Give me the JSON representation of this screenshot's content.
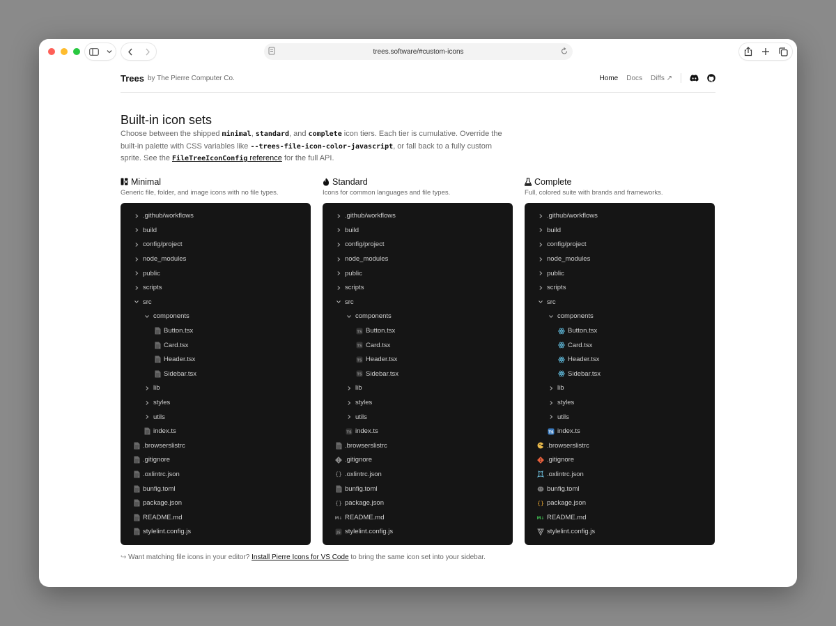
{
  "browser": {
    "url": "trees.software/#custom-icons"
  },
  "nav": {
    "brand": "Trees",
    "by": "by The Pierre Computer Co.",
    "links": [
      "Home",
      "Docs",
      "Diffs ↗"
    ]
  },
  "section": {
    "title": "Built-in icon sets",
    "desc_1": "Choose between the shipped ",
    "code_minimal": "minimal",
    "desc_2": ", ",
    "code_standard": "standard",
    "desc_3": ", and ",
    "code_complete": "complete",
    "desc_4": " icon tiers. Each tier is cumulative. Override the built-in palette with CSS variables like ",
    "code_var": "--trees-file-icon-color-javascript",
    "desc_5": ", or fall back to a fully custom sprite. See the ",
    "code_ref": "FileTreeIconConfig",
    "ref_label": " reference",
    "desc_6": " for the full API."
  },
  "columns": [
    {
      "title": "Minimal",
      "icon": "tree-icon",
      "subtitle": "Generic file, folder, and image icons with no file types."
    },
    {
      "title": "Standard",
      "icon": "flame-icon",
      "subtitle": "Icons for common languages and file types."
    },
    {
      "title": "Complete",
      "icon": "flask-icon",
      "subtitle": "Full, colored suite with brands and frameworks."
    }
  ],
  "tree": [
    {
      "label": ".github/workflows",
      "depth": 0,
      "type": "folder",
      "open": false
    },
    {
      "label": "build",
      "depth": 0,
      "type": "folder",
      "open": false
    },
    {
      "label": "config/project",
      "depth": 0,
      "type": "folder",
      "open": false
    },
    {
      "label": "node_modules",
      "depth": 0,
      "type": "folder",
      "open": false
    },
    {
      "label": "public",
      "depth": 0,
      "type": "folder",
      "open": false
    },
    {
      "label": "scripts",
      "depth": 0,
      "type": "folder",
      "open": false
    },
    {
      "label": "src",
      "depth": 0,
      "type": "folder",
      "open": true
    },
    {
      "label": "components",
      "depth": 1,
      "type": "folder",
      "open": true
    },
    {
      "label": "Button.tsx",
      "depth": 2,
      "type": "file",
      "std": "ts",
      "cmp": "react"
    },
    {
      "label": "Card.tsx",
      "depth": 2,
      "type": "file",
      "std": "ts",
      "cmp": "react"
    },
    {
      "label": "Header.tsx",
      "depth": 2,
      "type": "file",
      "std": "ts",
      "cmp": "react"
    },
    {
      "label": "Sidebar.tsx",
      "depth": 2,
      "type": "file",
      "std": "ts",
      "cmp": "react"
    },
    {
      "label": "lib",
      "depth": 1,
      "type": "folder",
      "open": false
    },
    {
      "label": "styles",
      "depth": 1,
      "type": "folder",
      "open": false
    },
    {
      "label": "utils",
      "depth": 1,
      "type": "folder",
      "open": false
    },
    {
      "label": "index.ts",
      "depth": 1,
      "type": "file",
      "std": "ts",
      "cmp": "tsblue"
    },
    {
      "label": ".browserslistrc",
      "depth": 0,
      "type": "file",
      "std": "doc",
      "cmp": "browsers"
    },
    {
      "label": ".gitignore",
      "depth": 0,
      "type": "file",
      "std": "git",
      "cmp": "git"
    },
    {
      "label": ".oxlintrc.json",
      "depth": 0,
      "type": "file",
      "std": "json",
      "cmp": "oxlint"
    },
    {
      "label": "bunfig.toml",
      "depth": 0,
      "type": "file",
      "std": "doc",
      "cmp": "bun"
    },
    {
      "label": "package.json",
      "depth": 0,
      "type": "file",
      "std": "json",
      "cmp": "jsonorange"
    },
    {
      "label": "README.md",
      "depth": 0,
      "type": "file",
      "std": "md",
      "cmp": "md"
    },
    {
      "label": "stylelint.config.js",
      "depth": 0,
      "type": "file",
      "std": "js",
      "cmp": "stylelint"
    }
  ],
  "hint": {
    "before": "Want matching file icons in your editor? ",
    "link": "Install Pierre Icons for VS Code",
    "after": " to bring the same icon set into your sidebar."
  },
  "colors": {
    "panel": "#151515",
    "react": "#5fb8d9",
    "ts": "#3b7bbf",
    "git": "#e8603c",
    "json": "#e0a030",
    "md": "#3fb950"
  }
}
